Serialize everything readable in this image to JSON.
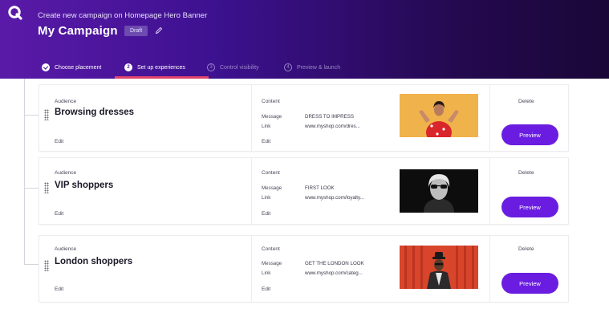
{
  "header": {
    "breadcrumb": "Create new campaign on Homepage Hero Banner",
    "title": "My Campaign",
    "badge": "Draft"
  },
  "steps": [
    {
      "label": "Choose placement",
      "state": "done",
      "number": ""
    },
    {
      "label": "Set up experiences",
      "state": "active",
      "number": "2"
    },
    {
      "label": "Control visibility",
      "state": "pending",
      "number": "3"
    },
    {
      "label": "Preview & launch",
      "state": "pending",
      "number": "4"
    }
  ],
  "labels": {
    "audience": "Audience",
    "content": "Content",
    "message": "Message",
    "link": "Link",
    "edit": "Edit",
    "delete": "Delete",
    "preview": "Preview"
  },
  "experiences": [
    {
      "audience": "Browsing dresses",
      "message": "DRESS TO IMPRESS",
      "link": "www.myshop.com/dres...",
      "image": "woman-in-red-dress-on-orange"
    },
    {
      "audience": "VIP shoppers",
      "message": "FIRST LOOK",
      "link": "www.myshop.com/loyalty...",
      "image": "woman-in-sunglasses-black-and-white"
    },
    {
      "audience": "London shoppers",
      "message": "GET THE LONDON LOOK",
      "link": "www.myshop.com/categ...",
      "image": "man-in-hat-on-red-background"
    }
  ],
  "colors": {
    "header_start": "#5a1aa8",
    "header_end": "#1a0738",
    "accent": "#6a1de0",
    "active_step_bar": "#e0446a"
  }
}
